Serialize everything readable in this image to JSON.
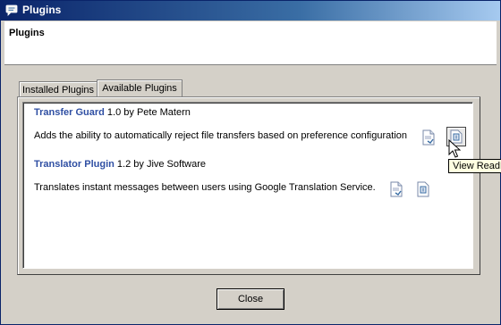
{
  "window": {
    "title": "Plugins"
  },
  "header": {
    "title": "Plugins"
  },
  "tabs": [
    {
      "label": "Installed Plugins",
      "selected": false
    },
    {
      "label": "Available Plugins",
      "selected": true
    }
  ],
  "plugins": [
    {
      "name": "Transfer Guard",
      "meta": "1.0 by Pete Matern",
      "description": "Adds the ability to automatically reject file transfers based on preference configuration"
    },
    {
      "name": "Translator Plugin",
      "meta": "1.2 by Jive Software",
      "description": "Translates instant messages between users using Google Translation Service."
    }
  ],
  "tooltip": {
    "text": "View ReadM"
  },
  "buttons": {
    "close_label": "Close"
  },
  "icons": {
    "app": "chat-bubble-icon",
    "changelog": "changelog-document-icon",
    "readme": "readme-document-icon",
    "cursor": "mouse-pointer-icon"
  },
  "colors": {
    "plugin_name": "#2f4fa3",
    "title_bar": "#0a246a"
  }
}
